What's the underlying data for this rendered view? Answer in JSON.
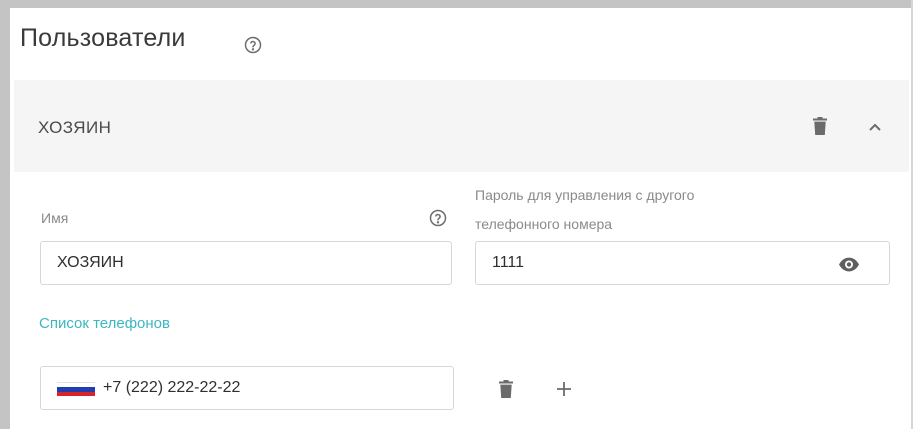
{
  "page": {
    "title": "Пользователи",
    "help_icon": "help-circle-icon"
  },
  "user": {
    "header_title": "ХОЗЯИН",
    "delete_icon": "trash-icon",
    "collapse_icon": "chevron-up-icon",
    "name_field": {
      "label": "Имя",
      "value": "ХОЗЯИН",
      "help_icon": "help-circle-icon"
    },
    "password_field": {
      "label_line1": "Пароль для управления с другого",
      "label_line2": "телефонного номера",
      "value": "1111",
      "visibility_icon": "eye-icon"
    },
    "phones": {
      "section_label": "Список телефонов",
      "items": [
        {
          "country_flag": "flag-ru-icon",
          "number": "+7 (222) 222-22-22",
          "delete_icon": "trash-icon",
          "add_icon": "plus-icon"
        }
      ]
    }
  },
  "colors": {
    "accent": "#3bb7c4",
    "header_bg": "#f5f5f5",
    "border": "#d7d7d7",
    "flag_white": "#ffffff",
    "flag_blue": "#1f3fb0",
    "flag_red": "#d8232a"
  }
}
